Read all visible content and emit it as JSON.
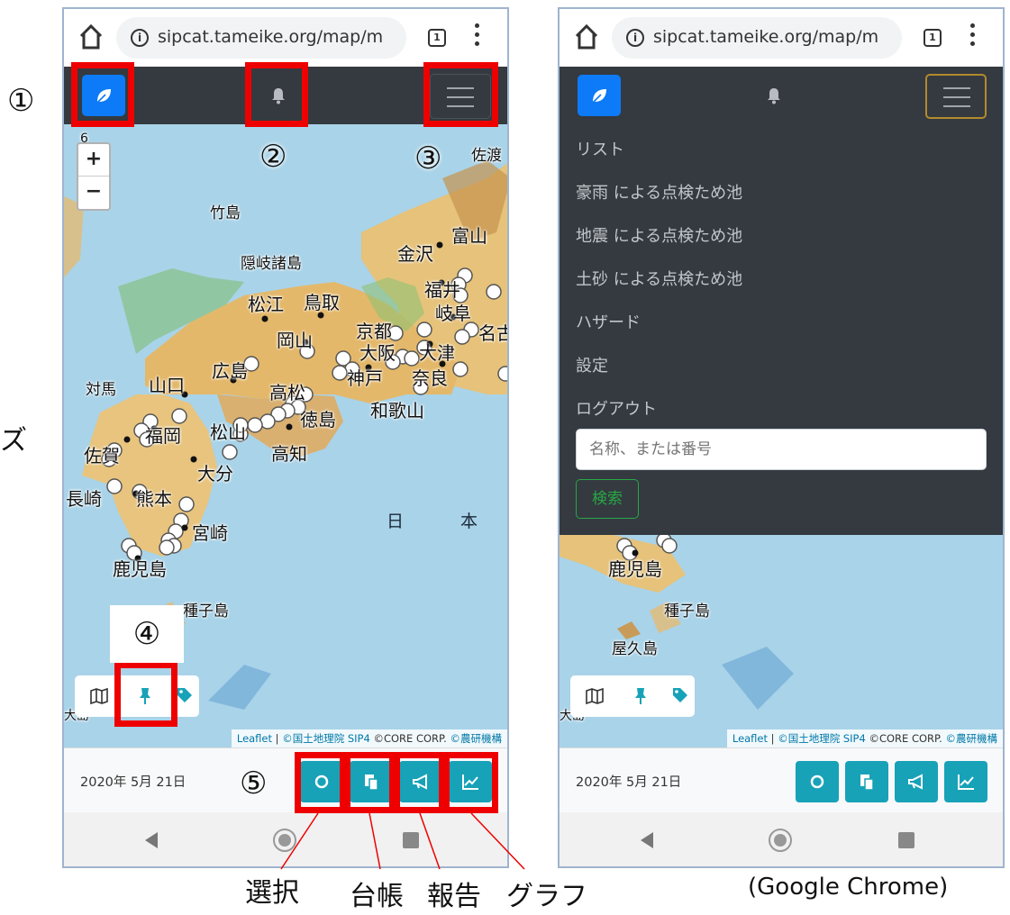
{
  "browser": {
    "url": "sipcat.tameike.org/map/m",
    "tab_count": "1"
  },
  "map": {
    "zoom_in": "+",
    "zoom_out": "−",
    "zoom_level": "6",
    "labels": {
      "sado": "佐渡",
      "takeshima": "竹島",
      "oki": "隠岐諸島",
      "toyama": "富山",
      "kanazawa": "金沢",
      "fukui": "福井",
      "gifu": "岐阜",
      "nagoya": "名古屋",
      "matsue": "松江",
      "tottori": "鳥取",
      "okayama": "岡山",
      "kyoto": "京都",
      "osaka": "大阪",
      "otsu": "大津",
      "kobe": "神戸",
      "nara": "奈良",
      "wakayama": "和歌山",
      "tsushima": "対馬",
      "yamaguchi": "山口",
      "hiroshima": "広島",
      "takamatsu": "高松",
      "tokushima": "徳島",
      "matsuyama": "松山",
      "kochi": "高知",
      "fukuoka": "福岡",
      "saga": "佐賀",
      "oita": "大分",
      "nagasaki": "長崎",
      "kumamoto": "熊本",
      "miyazaki": "宮崎",
      "kagoshima": "鹿児島",
      "tanegashima": "種子島",
      "yakushima": "屋久島",
      "amami": "大島",
      "sea_left": "日",
      "sea_right": "本"
    },
    "attribution": {
      "leaflet": "Leaflet",
      "gsi": "©国土地理院",
      "sip4": "SIP4",
      "core": "©CORE CORP.",
      "naro": "©農研機構"
    }
  },
  "footer": {
    "date": "2020年 5月 21日"
  },
  "menu": {
    "items": [
      "リスト",
      "豪雨 による点検ため池",
      "地震 による点検ため池",
      "土砂 による点検ため池",
      "ハザード",
      "設定",
      "ログアウト"
    ],
    "search_placeholder": "名称、または番号",
    "search_button": "検索"
  },
  "annotations": {
    "n1": "①",
    "n2": "②",
    "n3": "③",
    "n4": "④",
    "n5": "⑤",
    "select": "選択",
    "ledger": "台帳",
    "report": "報告",
    "graph": "グラフ",
    "browser_note": "(Google Chrome)",
    "left_edge_char": "ズ"
  },
  "colors": {
    "navbar": "#343a40",
    "brand_button": "#0d7bf7",
    "footer_button": "#17a2b8",
    "highlight": "#ee0000",
    "search_button": "#28a745",
    "marker_fill": "#ffffff",
    "sea": "#a9d3e8",
    "land": "#e6c27a"
  },
  "icons": {
    "home": "home-icon",
    "info": "info-icon",
    "more": "more-vert-icon",
    "brand": "leaf-icon",
    "notifications": "bell-icon",
    "menu": "hamburger-icon",
    "layers": [
      "map-icon",
      "pin-icon",
      "tag-icon"
    ],
    "footer": [
      "circle-icon",
      "copy-icon",
      "megaphone-icon",
      "chart-line-icon"
    ]
  }
}
